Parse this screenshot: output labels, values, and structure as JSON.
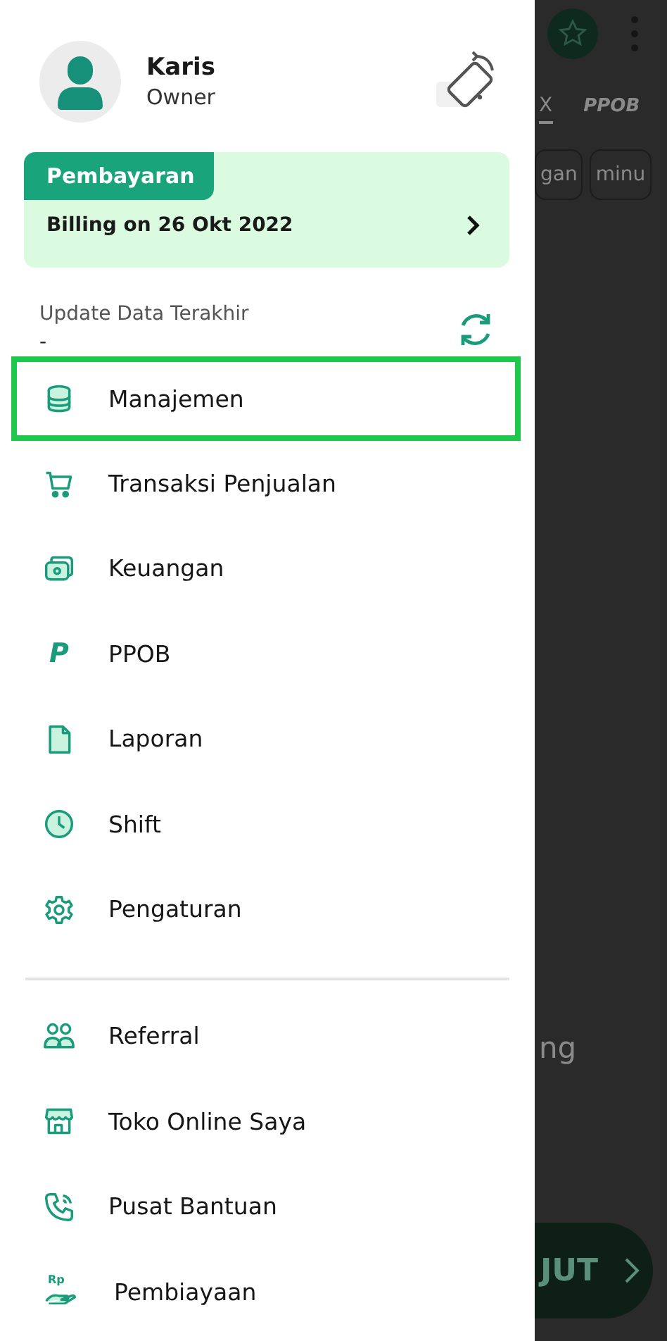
{
  "drawer": {
    "profile": {
      "name": "Karis",
      "role": "Owner"
    },
    "payment": {
      "tag": "Pembayaran",
      "billing": "Billing on 26 Okt 2022"
    },
    "sync": {
      "label": "Update Data Terakhir",
      "value": "-"
    },
    "menu": [
      {
        "label": "Manajemen",
        "selected": true
      },
      {
        "label": "Transaksi Penjualan",
        "selected": false
      },
      {
        "label": "Keuangan",
        "selected": false
      },
      {
        "label": "PPOB",
        "selected": false,
        "icon_label": "P"
      },
      {
        "label": "Laporan",
        "selected": false
      },
      {
        "label": "Shift",
        "selected": false
      },
      {
        "label": "Pengaturan",
        "selected": false
      }
    ],
    "menu_secondary": [
      {
        "label": "Referral",
        "selected": false
      },
      {
        "label": "Toko Online Saya",
        "selected": false
      },
      {
        "label": "Pusat Bantuan",
        "selected": false
      },
      {
        "label": "Pembiayaan",
        "selected": false,
        "icon_label": "Rp"
      }
    ]
  },
  "background_screen": {
    "tabs": [
      {
        "label": "X",
        "selected": true
      },
      {
        "label": "PPOB",
        "selected": false
      }
    ],
    "chips": [
      "gan",
      "minu"
    ],
    "text": "ng",
    "button": {
      "label": "JUT"
    }
  }
}
